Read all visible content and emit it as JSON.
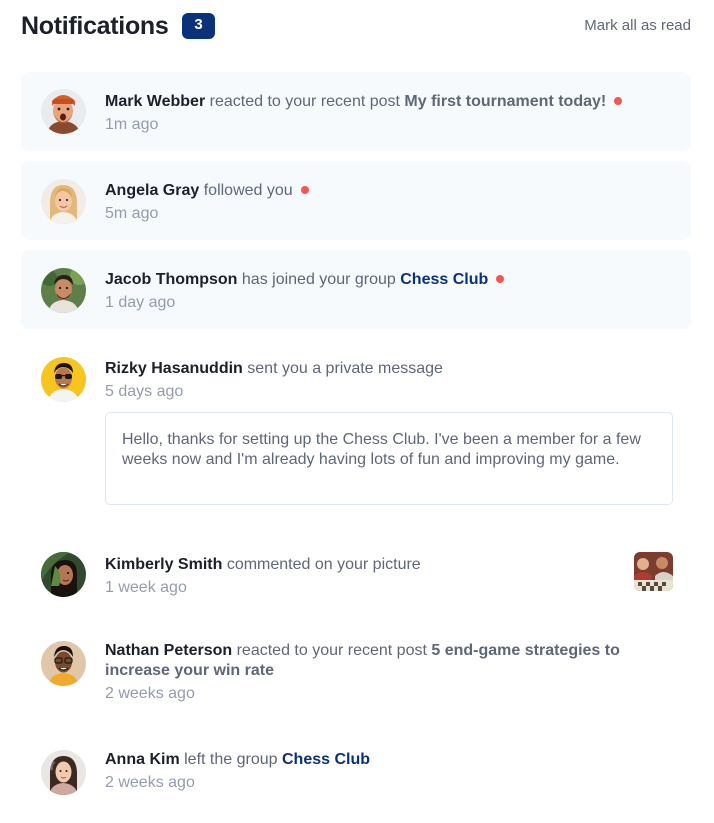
{
  "header": {
    "title": "Notifications",
    "unread_count": "3",
    "mark_all_label": "Mark all as read"
  },
  "colors": {
    "accent": "#0a327b",
    "unread_dot": "#f65552",
    "unread_bg": "#f7fafd",
    "heading": "#1c202b",
    "text": "#5e6778",
    "muted": "#939cad"
  },
  "notifications": [
    {
      "name": "Mark Webber",
      "action": "reacted to your recent post",
      "target": "My first tournament today!",
      "time": "1m ago",
      "unread": true,
      "avatar": "avatar-mark-webber"
    },
    {
      "name": "Angela Gray",
      "action": "followed you",
      "time": "5m ago",
      "unread": true,
      "avatar": "avatar-angela-gray"
    },
    {
      "name": "Jacob Thompson",
      "action": "has joined your group",
      "target": "Chess Club",
      "time": "1 day ago",
      "unread": true,
      "avatar": "avatar-jacob-thompson"
    },
    {
      "name": "Rizky Hasanuddin",
      "action": "sent you a private message",
      "time": "5 days ago",
      "unread": false,
      "avatar": "avatar-rizky-hasanuddin",
      "message": "Hello, thanks for setting up the Chess Club. I've been a member for a few weeks now and I'm already having lots of fun and improving my game."
    },
    {
      "name": "Kimberly Smith",
      "action": "commented on your picture",
      "time": "1 week ago",
      "unread": false,
      "avatar": "avatar-kimberly-smith",
      "picture": "chess-picture-thumbnail"
    },
    {
      "name": "Nathan Peterson",
      "action": "reacted to your recent post",
      "target": "5 end-game strategies to increase your win rate",
      "time": "2 weeks ago",
      "unread": false,
      "avatar": "avatar-nathan-peterson"
    },
    {
      "name": "Anna Kim",
      "action": "left the group",
      "target": "Chess Club",
      "time": "2 weeks ago",
      "unread": false,
      "avatar": "avatar-anna-kim"
    }
  ]
}
